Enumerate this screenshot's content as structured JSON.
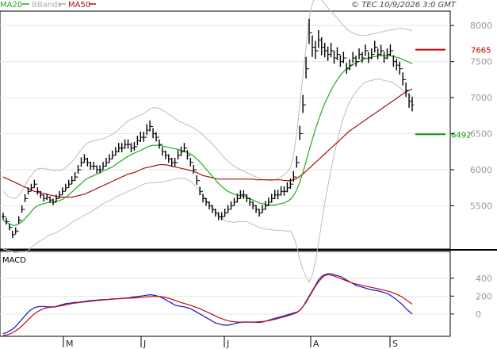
{
  "header": {
    "legend": [
      {
        "label": "MA20",
        "color": "#22aa22"
      },
      {
        "label": "BBands",
        "color": "#b0b0b0"
      },
      {
        "label": "MA50",
        "color": "#aa1111"
      }
    ],
    "copyright": "© TEC 10/9/2026 3:0 GMT"
  },
  "chart_data": [
    {
      "type": "ohlc",
      "title": "",
      "ylim": [
        4900,
        8200
      ],
      "yticks": [
        5500,
        6000,
        6500,
        7000,
        7500,
        8000
      ],
      "xticks": [
        "M",
        "J",
        "J",
        "A",
        "S"
      ],
      "markers": [
        {
          "label": "7665",
          "value": 7665,
          "color": "#bb0000"
        },
        {
          "label": "6492",
          "value": 6492,
          "color": "#009900"
        }
      ],
      "series": {
        "close": [
          5350,
          5280,
          5200,
          5100,
          5150,
          5300,
          5450,
          5600,
          5700,
          5750,
          5800,
          5700,
          5650,
          5600,
          5620,
          5580,
          5550,
          5600,
          5650,
          5700,
          5750,
          5800,
          5850,
          5900,
          6000,
          6100,
          6150,
          6100,
          6050,
          6050,
          6000,
          6000,
          6050,
          6100,
          6150,
          6200,
          6250,
          6300,
          6300,
          6350,
          6350,
          6300,
          6320,
          6400,
          6450,
          6450,
          6550,
          6600,
          6500,
          6450,
          6350,
          6250,
          6200,
          6150,
          6100,
          6100,
          6200,
          6250,
          6300,
          6200,
          6100,
          6000,
          5850,
          5700,
          5600,
          5550,
          5500,
          5450,
          5400,
          5350,
          5350,
          5400,
          5450,
          5500,
          5550,
          5600,
          5650,
          5650,
          5600,
          5550,
          5500,
          5450,
          5400,
          5450,
          5500,
          5550,
          5600,
          5650,
          5650,
          5700,
          5700,
          5750,
          5800,
          5900,
          6100,
          6500,
          6900,
          7400,
          7900,
          7700,
          7650,
          7800,
          7700,
          7650,
          7600,
          7650,
          7550,
          7600,
          7500,
          7550,
          7400,
          7450,
          7550,
          7500,
          7600,
          7550,
          7650,
          7550,
          7600,
          7700,
          7600,
          7650,
          7550,
          7600,
          7650,
          7500,
          7450,
          7400,
          7250,
          7100,
          6950,
          6900
        ],
        "range": [
          100,
          90,
          90,
          100,
          90,
          100,
          100,
          110,
          100,
          100,
          110,
          100,
          100,
          90,
          90,
          90,
          90,
          100,
          100,
          100,
          100,
          110,
          110,
          120,
          120,
          130,
          120,
          120,
          110,
          110,
          110,
          110,
          110,
          120,
          120,
          120,
          120,
          130,
          130,
          130,
          130,
          130,
          120,
          130,
          140,
          140,
          150,
          150,
          140,
          130,
          130,
          120,
          120,
          120,
          120,
          120,
          130,
          130,
          130,
          130,
          120,
          120,
          130,
          120,
          120,
          110,
          110,
          110,
          110,
          110,
          110,
          110,
          110,
          110,
          110,
          120,
          120,
          120,
          110,
          110,
          110,
          110,
          110,
          110,
          120,
          120,
          120,
          130,
          130,
          130,
          130,
          140,
          140,
          150,
          160,
          200,
          250,
          300,
          350,
          300,
          250,
          250,
          250,
          200,
          200,
          200,
          180,
          180,
          160,
          160,
          150,
          150,
          150,
          150,
          150,
          150,
          160,
          150,
          150,
          160,
          150,
          150,
          150,
          150,
          160,
          160,
          160,
          180,
          180,
          200,
          200,
          200
        ],
        "ma20": [
          5300,
          5270,
          5250,
          5230,
          5230,
          5250,
          5280,
          5320,
          5370,
          5420,
          5470,
          5500,
          5520,
          5530,
          5540,
          5550,
          5550,
          5560,
          5570,
          5590,
          5620,
          5650,
          5690,
          5730,
          5770,
          5810,
          5850,
          5880,
          5900,
          5920,
          5940,
          5960,
          5980,
          6000,
          6020,
          6040,
          6070,
          6100,
          6130,
          6160,
          6190,
          6210,
          6230,
          6250,
          6270,
          6290,
          6310,
          6330,
          6340,
          6340,
          6340,
          6330,
          6320,
          6310,
          6300,
          6290,
          6280,
          6270,
          6260,
          6240,
          6220,
          6190,
          6150,
          6110,
          6060,
          6010,
          5960,
          5910,
          5860,
          5810,
          5770,
          5730,
          5700,
          5680,
          5660,
          5650,
          5640,
          5630,
          5620,
          5600,
          5580,
          5560,
          5540,
          5530,
          5520,
          5510,
          5510,
          5510,
          5520,
          5530,
          5540,
          5560,
          5590,
          5640,
          5720,
          5830,
          5960,
          6110,
          6270,
          6420,
          6560,
          6690,
          6810,
          6920,
          7010,
          7100,
          7180,
          7250,
          7310,
          7360,
          7400,
          7430,
          7460,
          7480,
          7500,
          7520,
          7540,
          7550,
          7560,
          7570,
          7580,
          7580,
          7580,
          7580,
          7580,
          7570,
          7560,
          7550,
          7530,
          7510,
          7490,
          7470
        ],
        "ma50": [
          5900,
          5880,
          5860,
          5840,
          5820,
          5800,
          5780,
          5760,
          5740,
          5720,
          5700,
          5690,
          5680,
          5670,
          5660,
          5650,
          5640,
          5630,
          5620,
          5620,
          5620,
          5620,
          5620,
          5630,
          5640,
          5650,
          5660,
          5680,
          5700,
          5720,
          5740,
          5760,
          5780,
          5800,
          5820,
          5840,
          5860,
          5880,
          5900,
          5920,
          5940,
          5950,
          5960,
          5980,
          6000,
          6020,
          6030,
          6040,
          6050,
          6060,
          6070,
          6070,
          6070,
          6060,
          6050,
          6040,
          6030,
          6020,
          6010,
          6000,
          5990,
          5980,
          5960,
          5940,
          5920,
          5910,
          5900,
          5890,
          5880,
          5870,
          5870,
          5870,
          5870,
          5870,
          5870,
          5870,
          5870,
          5870,
          5870,
          5870,
          5870,
          5860,
          5860,
          5860,
          5860,
          5860,
          5860,
          5860,
          5860,
          5860,
          5850,
          5850,
          5850,
          5860,
          5880,
          5910,
          5940,
          5980,
          6020,
          6060,
          6100,
          6140,
          6180,
          6220,
          6260,
          6300,
          6340,
          6380,
          6420,
          6460,
          6500,
          6540,
          6570,
          6600,
          6630,
          6660,
          6690,
          6720,
          6750,
          6780,
          6810,
          6840,
          6870,
          6900,
          6930,
          6960,
          6990,
          7020,
          7050,
          7080,
          7100,
          7120
        ],
        "bb_upper": [
          5700,
          5650,
          5620,
          5600,
          5610,
          5640,
          5700,
          5780,
          5860,
          5920,
          5980,
          6010,
          6020,
          6020,
          6010,
          6000,
          5990,
          5990,
          5990,
          6000,
          6030,
          6070,
          6110,
          6160,
          6220,
          6280,
          6330,
          6370,
          6390,
          6400,
          6410,
          6420,
          6430,
          6450,
          6470,
          6490,
          6520,
          6560,
          6600,
          6640,
          6680,
          6700,
          6720,
          6740,
          6760,
          6780,
          6810,
          6840,
          6860,
          6860,
          6850,
          6830,
          6800,
          6770,
          6740,
          6710,
          6680,
          6660,
          6640,
          6620,
          6600,
          6580,
          6550,
          6520,
          6480,
          6440,
          6400,
          6360,
          6310,
          6260,
          6210,
          6160,
          6120,
          6080,
          6050,
          6020,
          6000,
          5980,
          5960,
          5940,
          5920,
          5900,
          5880,
          5870,
          5860,
          5850,
          5850,
          5860,
          5880,
          5900,
          5930,
          5970,
          6030,
          6200,
          6500,
          6900,
          7300,
          7700,
          8100,
          8300,
          8400,
          8400,
          8350,
          8300,
          8250,
          8200,
          8150,
          8100,
          8050,
          8000,
          7950,
          7920,
          7900,
          7880,
          7870,
          7860,
          7860,
          7870,
          7880,
          7890,
          7900,
          7910,
          7920,
          7930,
          7940,
          7940,
          7950,
          7960,
          7960,
          7950,
          7940,
          7930
        ],
        "bb_lower": [
          4900,
          4890,
          4880,
          4860,
          4850,
          4860,
          4860,
          4860,
          4880,
          4920,
          4960,
          4990,
          5020,
          5040,
          5070,
          5100,
          5110,
          5130,
          5150,
          5180,
          5210,
          5230,
          5270,
          5300,
          5320,
          5340,
          5370,
          5390,
          5410,
          5440,
          5470,
          5500,
          5530,
          5550,
          5570,
          5590,
          5620,
          5640,
          5660,
          5680,
          5700,
          5720,
          5740,
          5760,
          5780,
          5800,
          5810,
          5820,
          5820,
          5820,
          5830,
          5830,
          5840,
          5850,
          5860,
          5870,
          5880,
          5880,
          5880,
          5860,
          5840,
          5800,
          5750,
          5700,
          5640,
          5580,
          5520,
          5460,
          5410,
          5360,
          5330,
          5300,
          5280,
          5280,
          5270,
          5280,
          5280,
          5280,
          5280,
          5260,
          5240,
          5220,
          5200,
          5190,
          5180,
          5170,
          5170,
          5160,
          5160,
          5160,
          5150,
          5150,
          5150,
          5080,
          4940,
          4760,
          4620,
          4520,
          4440,
          4540,
          4720,
          4980,
          5270,
          5540,
          5770,
          6000,
          6210,
          6400,
          6570,
          6720,
          6850,
          6940,
          7020,
          7080,
          7130,
          7180,
          7220,
          7230,
          7240,
          7250,
          7260,
          7250,
          7240,
          7230,
          7220,
          7200,
          7170,
          7140,
          7100,
          7070,
          7040,
          7010
        ]
      }
    },
    {
      "type": "line",
      "title": "MACD",
      "ylim": [
        -250,
        700
      ],
      "yticks": [
        0,
        200,
        400
      ],
      "series": [
        {
          "name": "",
          "color": "#1111cc",
          "values": [
            -220,
            -210,
            -190,
            -170,
            -140,
            -100,
            -60,
            -20,
            20,
            50,
            70,
            80,
            85,
            85,
            80,
            80,
            80,
            85,
            95,
            105,
            115,
            120,
            125,
            130,
            130,
            135,
            140,
            145,
            150,
            152,
            155,
            158,
            160,
            162,
            165,
            168,
            170,
            172,
            175,
            178,
            180,
            185,
            190,
            195,
            200,
            205,
            210,
            215,
            212,
            205,
            195,
            180,
            160,
            140,
            120,
            100,
            90,
            85,
            80,
            70,
            60,
            40,
            20,
            0,
            -20,
            -40,
            -60,
            -80,
            -100,
            -110,
            -120,
            -125,
            -125,
            -120,
            -110,
            -100,
            -95,
            -90,
            -90,
            -90,
            -90,
            -95,
            -95,
            -90,
            -80,
            -70,
            -60,
            -50,
            -40,
            -30,
            -20,
            -10,
            0,
            10,
            20,
            40,
            80,
            140,
            200,
            260,
            320,
            380,
            420,
            440,
            450,
            450,
            440,
            430,
            420,
            400,
            380,
            360,
            340,
            320,
            310,
            300,
            290,
            280,
            270,
            265,
            260,
            250,
            240,
            230,
            210,
            185,
            160,
            130,
            100,
            60,
            30,
            0
          ]
        },
        {
          "name": "",
          "color": "#bb1111",
          "values": [
            -240,
            -235,
            -225,
            -210,
            -190,
            -165,
            -135,
            -100,
            -65,
            -30,
            0,
            25,
            45,
            60,
            70,
            75,
            78,
            82,
            88,
            95,
            102,
            110,
            117,
            122,
            126,
            130,
            134,
            138,
            142,
            146,
            150,
            153,
            156,
            159,
            162,
            165,
            168,
            170,
            172,
            174,
            176,
            178,
            180,
            182,
            185,
            188,
            191,
            194,
            196,
            197,
            196,
            192,
            185,
            176,
            165,
            152,
            140,
            128,
            118,
            108,
            97,
            85,
            72,
            58,
            43,
            27,
            12,
            -5,
            -22,
            -38,
            -52,
            -65,
            -75,
            -82,
            -87,
            -90,
            -92,
            -92,
            -92,
            -92,
            -92,
            -90,
            -87,
            -84,
            -80,
            -75,
            -68,
            -60,
            -51,
            -42,
            -32,
            -22,
            -12,
            0,
            15,
            40,
            80,
            130,
            190,
            250,
            310,
            360,
            400,
            430,
            440,
            435,
            425,
            412,
            398,
            384,
            370,
            358,
            346,
            336,
            328,
            320,
            312,
            305,
            298,
            290,
            283,
            275,
            267,
            258,
            248,
            236,
            222,
            205,
            185,
            160,
            135,
            110
          ]
        }
      ]
    }
  ]
}
